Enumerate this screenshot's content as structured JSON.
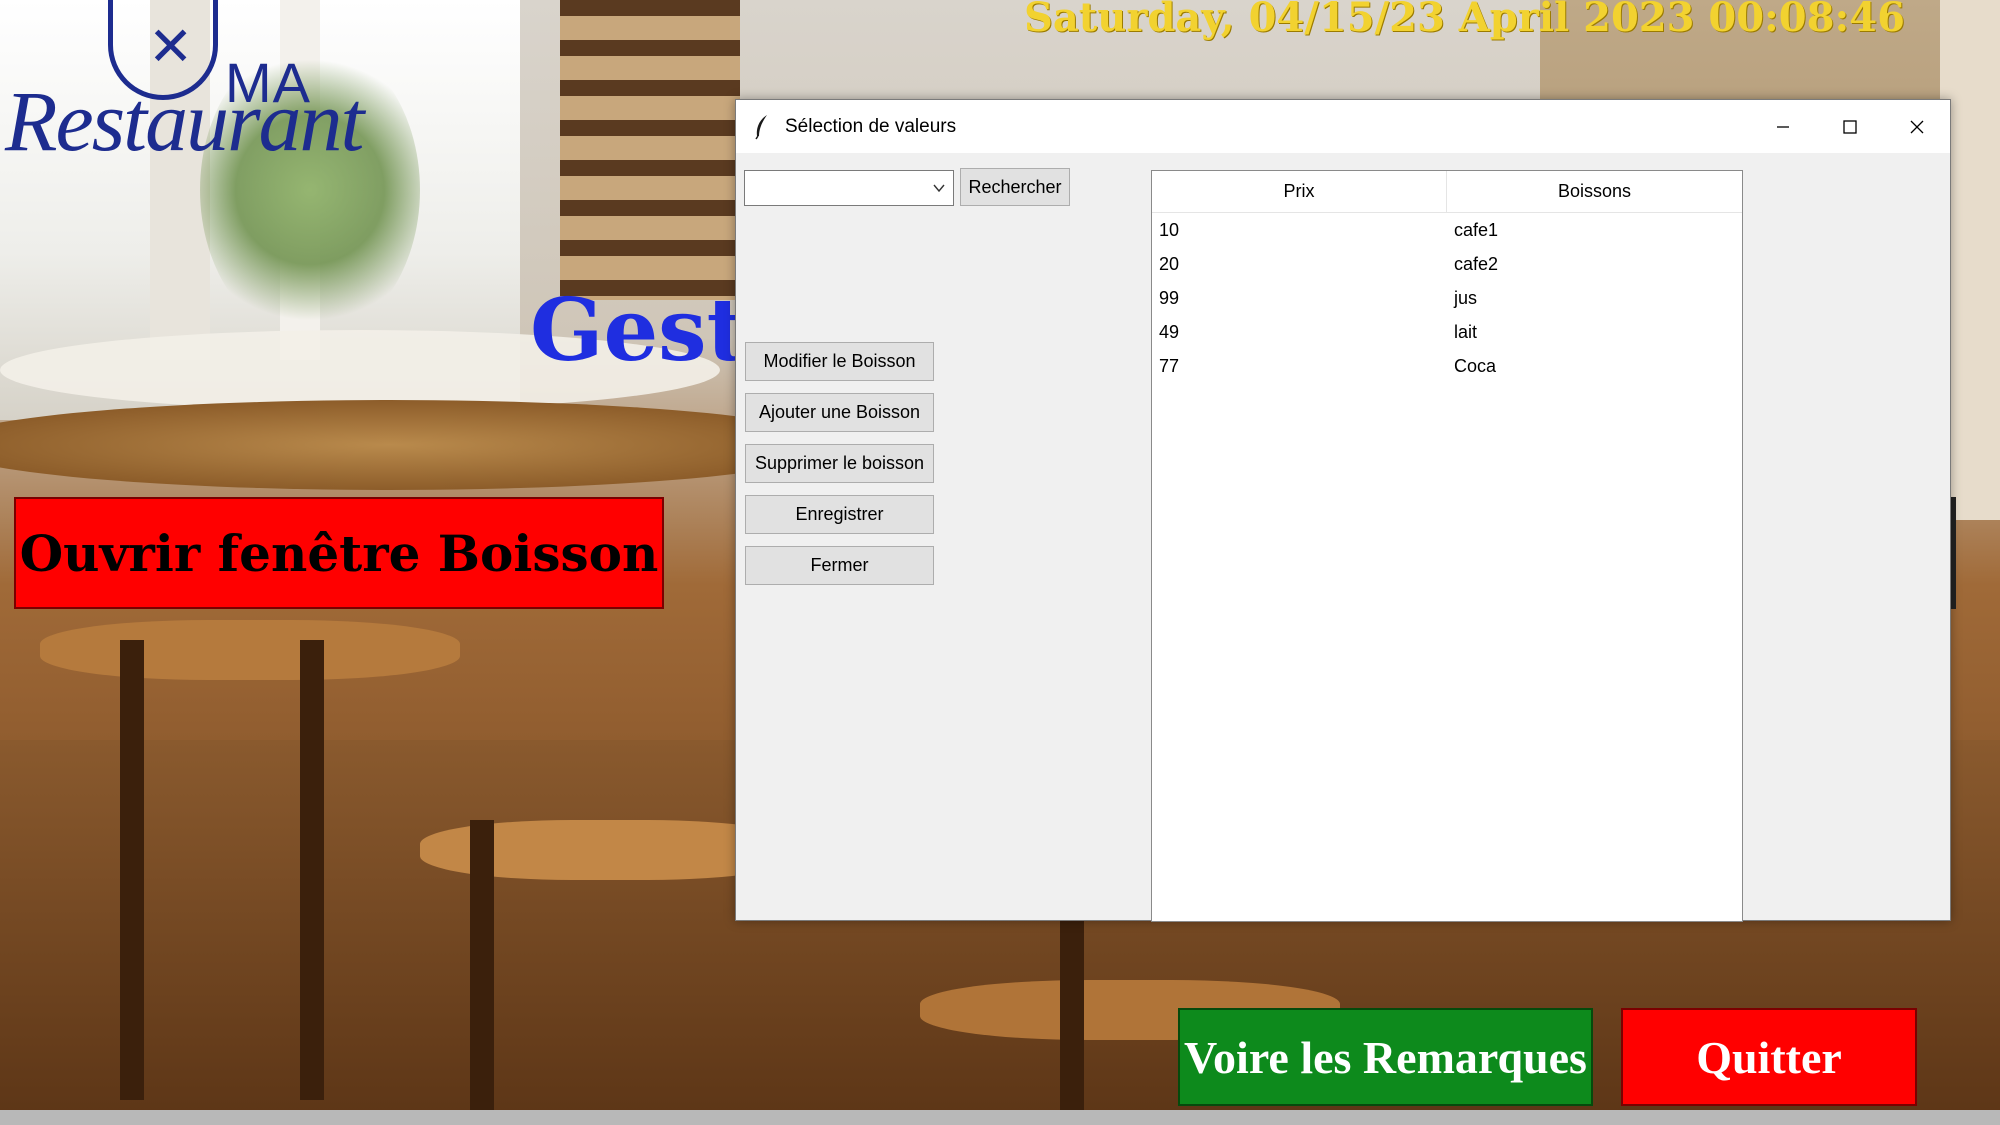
{
  "app": {
    "datetime": "Saturday, 04/15/23 April 2023 00:08:46",
    "logo": {
      "top": "MA",
      "main": "Restaurant"
    },
    "heading_partial": "Gesti",
    "open_drinks_button": "Ouvrir fenêtre Boisson",
    "remarks_button": "Voire les Remarques",
    "quit_button": "Quitter"
  },
  "dialog": {
    "title": "Sélection de valeurs",
    "search_combo_value": "",
    "search_button": "Rechercher",
    "actions": [
      {
        "label": "Modifier le Boisson"
      },
      {
        "label": "Ajouter une Boisson"
      },
      {
        "label": "Supprimer le boisson"
      },
      {
        "label": "Enregistrer"
      },
      {
        "label": "Fermer"
      }
    ],
    "table": {
      "columns": [
        "Prix",
        "Boissons"
      ],
      "rows": [
        [
          "10",
          "cafe1"
        ],
        [
          "20",
          "cafe2"
        ],
        [
          "99",
          "jus"
        ],
        [
          "49",
          "lait"
        ],
        [
          "77",
          "Coca"
        ]
      ]
    }
  },
  "colors": {
    "datetime": "#f2d230",
    "logo": "#1d2c8f",
    "heading": "#1f2ee0",
    "open_button": "#ff0000",
    "remarks_button": "#0d8a1c",
    "quit_button": "#ff0000"
  },
  "icons": [
    "feather-icon",
    "minimize-icon",
    "maximize-icon",
    "close-icon",
    "chevron-down-icon"
  ]
}
